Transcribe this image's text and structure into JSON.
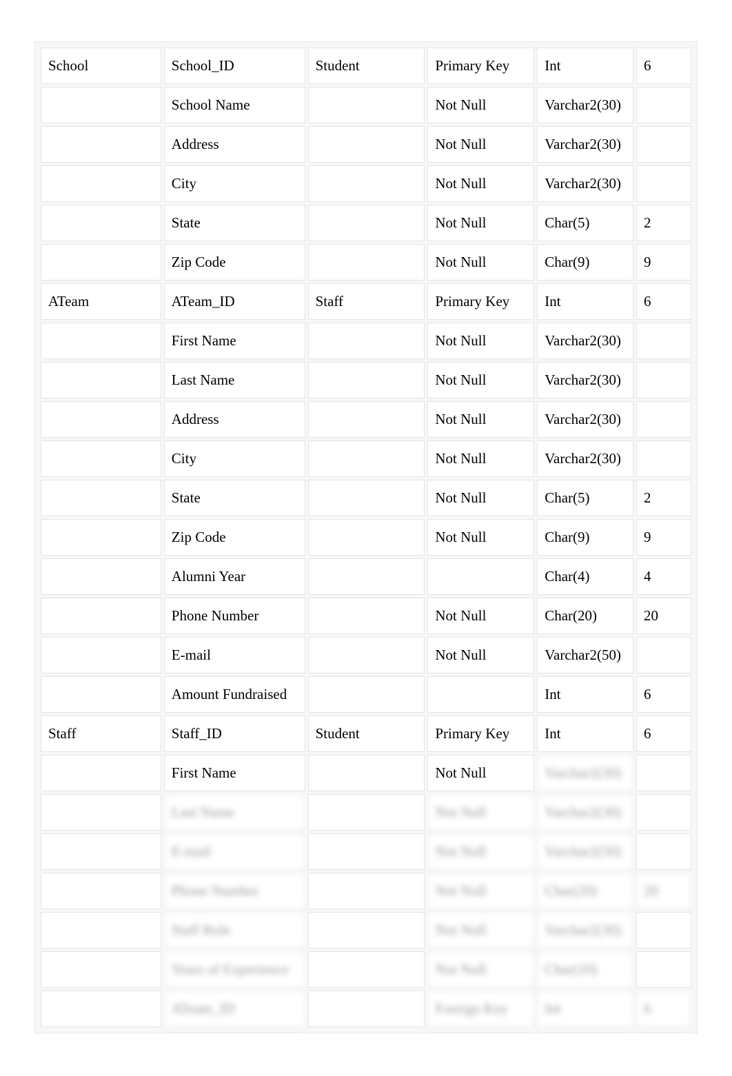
{
  "rows": [
    {
      "c0": "School",
      "c1": "School_ID",
      "c2": "Student",
      "c3": "Primary Key",
      "c4": "Int",
      "c5": "6",
      "blur": []
    },
    {
      "c0": "",
      "c1": "School Name",
      "c2": "",
      "c3": "Not Null",
      "c4": "Varchar2(30)",
      "c5": "",
      "blur": []
    },
    {
      "c0": "",
      "c1": "Address",
      "c2": "",
      "c3": "Not Null",
      "c4": "Varchar2(30)",
      "c5": "",
      "blur": []
    },
    {
      "c0": "",
      "c1": "City",
      "c2": "",
      "c3": "Not Null",
      "c4": "Varchar2(30)",
      "c5": "",
      "blur": []
    },
    {
      "c0": "",
      "c1": "State",
      "c2": "",
      "c3": "Not Null",
      "c4": "Char(5)",
      "c5": "2",
      "blur": []
    },
    {
      "c0": "",
      "c1": "Zip Code",
      "c2": "",
      "c3": "Not Null",
      "c4": "Char(9)",
      "c5": "9",
      "blur": []
    },
    {
      "c0": "ATeam",
      "c1": "ATeam_ID",
      "c2": "Staff",
      "c3": "Primary Key",
      "c4": "Int",
      "c5": "6",
      "blur": []
    },
    {
      "c0": "",
      "c1": "First Name",
      "c2": "",
      "c3": "Not Null",
      "c4": "Varchar2(30)",
      "c5": "",
      "blur": []
    },
    {
      "c0": "",
      "c1": "Last Name",
      "c2": "",
      "c3": "Not Null",
      "c4": "Varchar2(30)",
      "c5": "",
      "blur": []
    },
    {
      "c0": "",
      "c1": "Address",
      "c2": "",
      "c3": "Not Null",
      "c4": "Varchar2(30)",
      "c5": "",
      "blur": []
    },
    {
      "c0": "",
      "c1": "City",
      "c2": "",
      "c3": "Not Null",
      "c4": "Varchar2(30)",
      "c5": "",
      "blur": []
    },
    {
      "c0": "",
      "c1": "State",
      "c2": "",
      "c3": "Not Null",
      "c4": "Char(5)",
      "c5": "2",
      "blur": []
    },
    {
      "c0": "",
      "c1": "Zip Code",
      "c2": "",
      "c3": "Not Null",
      "c4": "Char(9)",
      "c5": "9",
      "blur": []
    },
    {
      "c0": "",
      "c1": "Alumni Year",
      "c2": "",
      "c3": "",
      "c4": "Char(4)",
      "c5": "4",
      "blur": []
    },
    {
      "c0": "",
      "c1": "Phone Number",
      "c2": "",
      "c3": "Not Null",
      "c4": "Char(20)",
      "c5": "20",
      "blur": []
    },
    {
      "c0": "",
      "c1": "E-mail",
      "c2": "",
      "c3": "Not Null",
      "c4": "Varchar2(50)",
      "c5": "",
      "blur": []
    },
    {
      "c0": "",
      "c1": "Amount Fundraised",
      "c2": "",
      "c3": "",
      "c4": "Int",
      "c5": "6",
      "blur": []
    },
    {
      "c0": "Staff",
      "c1": "Staff_ID",
      "c2": "Student",
      "c3": "Primary Key",
      "c4": "Int",
      "c5": "6",
      "blur": []
    },
    {
      "c0": "",
      "c1": "First Name",
      "c2": "",
      "c3": "Not Null",
      "c4": "Varchar2(30)",
      "c5": "",
      "blur": [
        4
      ]
    },
    {
      "c0": "",
      "c1": "Last Name",
      "c2": "",
      "c3": "Not Null",
      "c4": "Varchar2(30)",
      "c5": "",
      "blur": [
        1,
        3,
        4
      ]
    },
    {
      "c0": "",
      "c1": "E-mail",
      "c2": "",
      "c3": "Not Null",
      "c4": "Varchar2(50)",
      "c5": "",
      "blur": [
        1,
        3,
        4
      ]
    },
    {
      "c0": "",
      "c1": "Phone Number",
      "c2": "",
      "c3": "Not Null",
      "c4": "Char(20)",
      "c5": "20",
      "blur": [
        1,
        3,
        4,
        5
      ]
    },
    {
      "c0": "",
      "c1": "Staff Role",
      "c2": "",
      "c3": "Not Null",
      "c4": "Varchar2(30)",
      "c5": "",
      "blur": [
        1,
        3,
        4
      ]
    },
    {
      "c0": "",
      "c1": "Years of Experience",
      "c2": "",
      "c3": "Not Null",
      "c4": "Char(10)",
      "c5": "",
      "blur": [
        1,
        3,
        4
      ]
    },
    {
      "c0": "",
      "c1": "ATeam_ID",
      "c2": "",
      "c3": "Foreign Key",
      "c4": "Int",
      "c5": "6",
      "blur": [
        1,
        3,
        4,
        5
      ]
    }
  ]
}
